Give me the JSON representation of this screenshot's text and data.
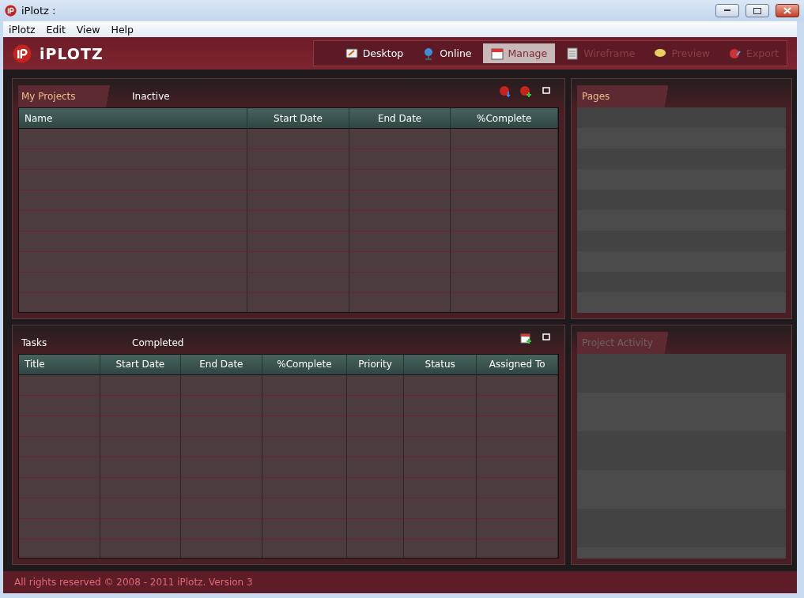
{
  "window": {
    "title": "iPlotz  :"
  },
  "menu": [
    "iPlotz",
    "Edit",
    "View",
    "Help"
  ],
  "logo": {
    "text": "iPLOTZ"
  },
  "toolbar": [
    {
      "label": "Desktop",
      "selected": false,
      "disabled": false
    },
    {
      "label": "Online",
      "selected": false,
      "disabled": false
    },
    {
      "label": "Manage",
      "selected": true,
      "disabled": false
    },
    {
      "label": "Wireframe",
      "selected": false,
      "disabled": true
    },
    {
      "label": "Preview",
      "selected": false,
      "disabled": true
    },
    {
      "label": "Export",
      "selected": false,
      "disabled": true
    }
  ],
  "projects": {
    "tabs": [
      {
        "label": "My Projects",
        "selected": true
      },
      {
        "label": "Inactive",
        "selected": false
      }
    ],
    "columns": [
      "Name",
      "Start Date",
      "End Date",
      "%Complete"
    ]
  },
  "tasks": {
    "tabs": [
      {
        "label": "Tasks",
        "selected": false
      },
      {
        "label": "Completed",
        "selected": false
      }
    ],
    "columns": [
      "Title",
      "Start Date",
      "End Date",
      "%Complete",
      "Priority",
      "Status",
      "Assigned To"
    ]
  },
  "side_panels": [
    {
      "title": "Pages",
      "active": true
    },
    {
      "title": "Project Activity",
      "active": false
    }
  ],
  "status_bar": "All rights reserved © 2008 - 2011 iPlotz. Version 3"
}
